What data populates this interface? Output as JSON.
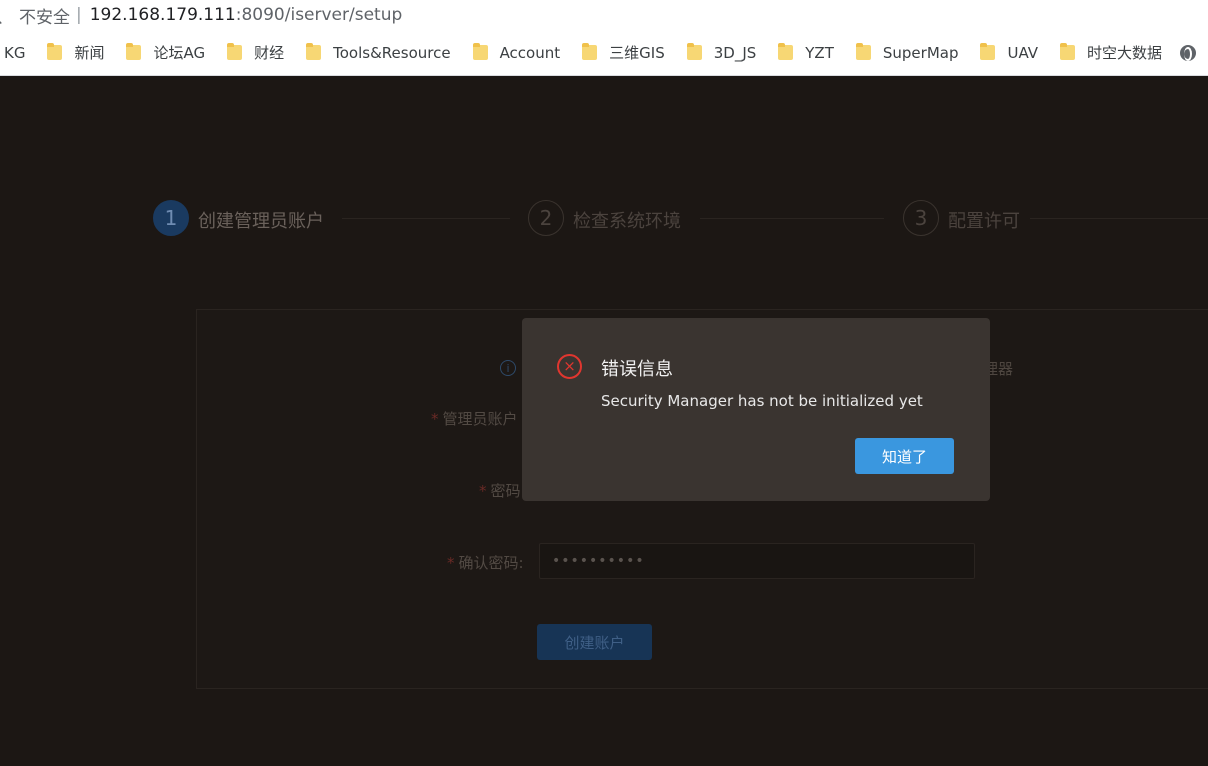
{
  "browser": {
    "address_prefix": "、",
    "insecure_label": "不安全",
    "separator": "|",
    "url_host": "192.168.179.111",
    "url_path": ":8090/iserver/setup"
  },
  "bookmarks": {
    "items": [
      {
        "label": "KG",
        "has_folder": false
      },
      {
        "label": "新闻",
        "has_folder": true
      },
      {
        "label": "论坛AG",
        "has_folder": true
      },
      {
        "label": "财经",
        "has_folder": true
      },
      {
        "label": "Tools&Resource",
        "has_folder": true
      },
      {
        "label": "Account",
        "has_folder": true
      },
      {
        "label": "三维GIS",
        "has_folder": true
      },
      {
        "label": "3D_JS",
        "has_folder": true
      },
      {
        "label": "YZT",
        "has_folder": true
      },
      {
        "label": "SuperMap",
        "has_folder": true
      },
      {
        "label": "UAV",
        "has_folder": true
      },
      {
        "label": "时空大数据",
        "has_folder": true
      }
    ]
  },
  "steps": [
    {
      "number": "1",
      "label": "创建管理员账户",
      "active": true
    },
    {
      "number": "2",
      "label": "检查系统环境",
      "active": false
    },
    {
      "number": "3",
      "label": "配置许可",
      "active": false
    }
  ],
  "form": {
    "info_icon": "i",
    "info_tail": "理器",
    "required_mark": "*",
    "admin_label": "管理员账户",
    "password_label": "密码",
    "confirm_label": "确认密码:",
    "confirm_value": "••••••••••",
    "submit_label": "创建账户"
  },
  "modal": {
    "icon": "×",
    "title": "错误信息",
    "message": "Security Manager has not be initialized yet",
    "ok_label": "知道了",
    "accent": "#3a97df",
    "error_color": "#e0362f"
  }
}
